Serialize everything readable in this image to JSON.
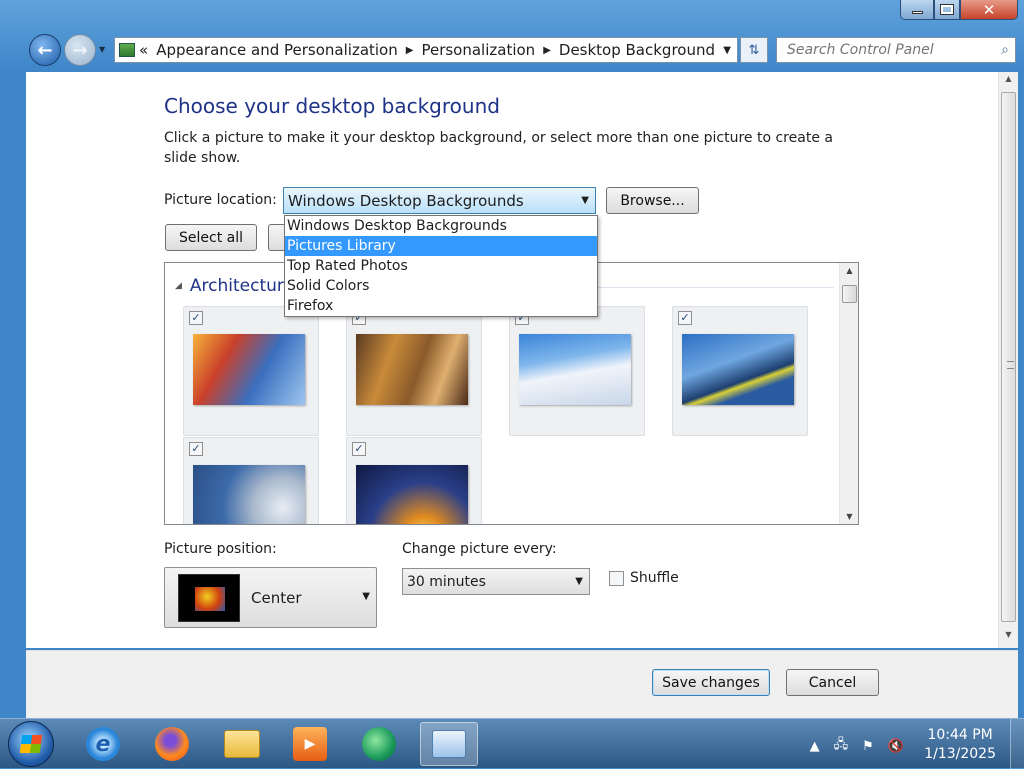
{
  "address_bar": {
    "overflow": "«",
    "crumbs": [
      "Appearance and Personalization",
      "Personalization",
      "Desktop Background"
    ]
  },
  "search": {
    "placeholder": "Search Control Panel"
  },
  "page": {
    "title": "Choose your desktop background",
    "description": "Click a picture to make it your desktop background, or select more than one picture to create a slide show."
  },
  "picture_location": {
    "label": "Picture location:",
    "selected": "Windows Desktop Backgrounds",
    "browse_label": "Browse...",
    "options": [
      "Windows Desktop Backgrounds",
      "Pictures Library",
      "Top Rated Photos",
      "Solid Colors",
      "Firefox"
    ],
    "highlighted_option": "Pictures Library"
  },
  "selection": {
    "select_all": "Select all"
  },
  "gallery": {
    "group": "Architecture",
    "tiles": [
      {
        "checked": true
      },
      {
        "checked": true
      },
      {
        "checked": true
      },
      {
        "checked": true
      },
      {
        "checked": true
      },
      {
        "checked": true
      }
    ]
  },
  "picture_position": {
    "label": "Picture position:",
    "value": "Center"
  },
  "change_picture": {
    "label": "Change picture every:",
    "value": "30 minutes"
  },
  "shuffle": {
    "label": "Shuffle",
    "checked": false
  },
  "footer": {
    "save": "Save changes",
    "cancel": "Cancel"
  },
  "taskbar": {
    "apps": [
      "internet-explorer-icon",
      "firefox-icon",
      "windows-explorer-icon",
      "media-player-icon",
      "chat-icon",
      "control-panel-icon"
    ],
    "active_app": "control-panel-icon",
    "time": "10:44 PM",
    "date": "1/13/2025"
  },
  "colors": {
    "title_blue": "#1e3287",
    "selection_blue": "#3399ff",
    "window_frame": "#3f86c9"
  }
}
